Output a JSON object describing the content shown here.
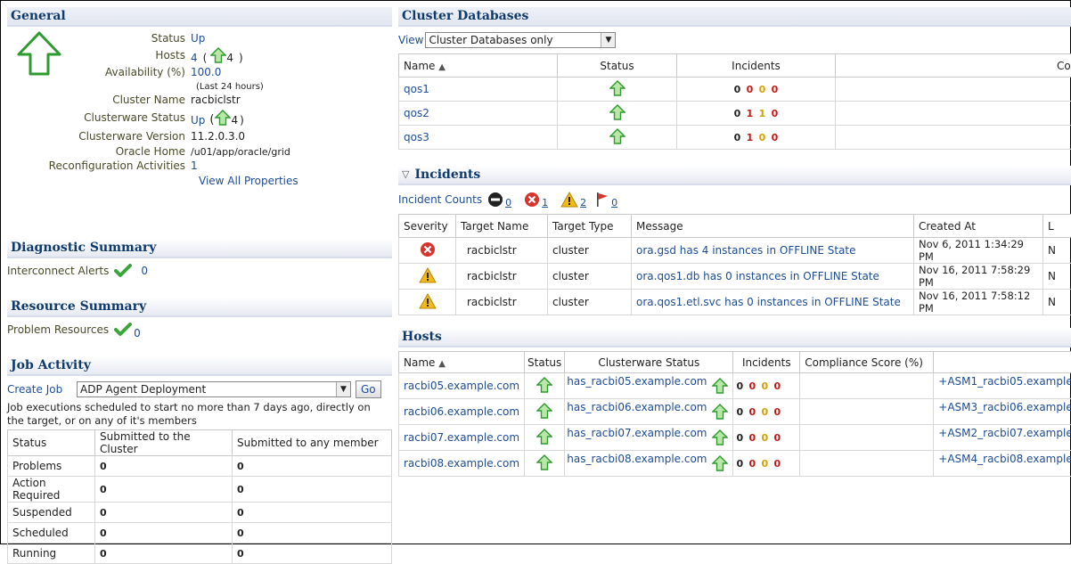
{
  "general": {
    "title": "General",
    "status_label": "Status",
    "status_value": "Up",
    "hosts_label": "Hosts",
    "hosts_value": "4",
    "hosts_paren_open": "(",
    "hosts_up_count": "4",
    "hosts_paren_close": ")",
    "availability_label": "Availability (%)",
    "availability_value": "100.0",
    "availability_note": "(Last 24 hours)",
    "cluster_name_label": "Cluster Name",
    "cluster_name_value": "racbiclstr",
    "cw_status_label": "Clusterware Status",
    "cw_status_value": "Up",
    "cw_paren_open": "(",
    "cw_up_count": "4",
    "cw_paren_close": ")",
    "cw_version_label": "Clusterware Version",
    "cw_version_value": "11.2.0.3.0",
    "oracle_home_label": "Oracle Home",
    "oracle_home_value": "/u01/app/oracle/grid",
    "reconfig_label": "Reconfiguration Activities",
    "reconfig_value": "1",
    "view_all": "View All Properties"
  },
  "diagnostic": {
    "title": "Diagnostic Summary",
    "interconnect_label": "Interconnect Alerts",
    "interconnect_value": "0"
  },
  "resource": {
    "title": "Resource Summary",
    "problem_label": "Problem Resources",
    "problem_value": "0"
  },
  "job": {
    "title": "Job Activity",
    "create_label": "Create Job",
    "select_value": "ADP Agent Deployment",
    "go": "Go",
    "desc": "Job executions scheduled to start no more than 7 days ago, directly on the target, or on any of it's members",
    "headers": [
      "Status",
      "Submitted to the Cluster",
      "Submitted to any member"
    ],
    "rows": [
      {
        "status": "Problems",
        "cluster": "0",
        "member": "0"
      },
      {
        "status": "Action Required",
        "cluster": "0",
        "member": "0"
      },
      {
        "status": "Suspended",
        "cluster": "0",
        "member": "0"
      },
      {
        "status": "Scheduled",
        "cluster": "0",
        "member": "0"
      },
      {
        "status": "Running",
        "cluster": "0",
        "member": "0"
      }
    ]
  },
  "cluster_db": {
    "title": "Cluster Databases",
    "view_label": "View",
    "view_value": "Cluster Databases only",
    "headers": [
      "Name",
      "Status",
      "Incidents",
      "Comp"
    ],
    "rows": [
      {
        "name": "qos1",
        "inc": [
          "0",
          "0",
          "0",
          "0"
        ]
      },
      {
        "name": "qos2",
        "inc": [
          "0",
          "1",
          "1",
          "0"
        ]
      },
      {
        "name": "qos3",
        "inc": [
          "0",
          "1",
          "0",
          "0"
        ]
      }
    ]
  },
  "incidents": {
    "title": "Incidents",
    "counts_label": "Incident Counts",
    "counts": [
      "0",
      "1",
      "2",
      "0"
    ],
    "headers": [
      "Severity",
      "Target Name",
      "Target Type",
      "Message",
      "Created At",
      "L"
    ],
    "rows": [
      {
        "sev": "critical",
        "target": "racbiclstr",
        "type": "cluster",
        "msg": "ora.gsd has 4 instances in OFFLINE State",
        "created": "Nov 6, 2011 1:34:29 PM",
        "l": "N"
      },
      {
        "sev": "warning",
        "target": "racbiclstr",
        "type": "cluster",
        "msg": "ora.qos1.db has 0 instances in OFFLINE State",
        "created": "Nov 16, 2011 7:58:29 PM",
        "l": "N"
      },
      {
        "sev": "warning",
        "target": "racbiclstr",
        "type": "cluster",
        "msg": "ora.qos1.etl.svc has 0 instances in OFFLINE State",
        "created": "Nov 16, 2011 7:58:12 PM",
        "l": "N"
      }
    ]
  },
  "hosts": {
    "title": "Hosts",
    "headers": [
      "Name",
      "Status",
      "Clusterware Status",
      "Incidents",
      "Compliance Score (%)",
      ""
    ],
    "rows": [
      {
        "name": "racbi05.example.com",
        "cw": "has_racbi05.example.com",
        "inc": [
          "0",
          "0",
          "0",
          "0"
        ],
        "asm": "+ASM1_racbi05.example"
      },
      {
        "name": "racbi06.example.com",
        "cw": "has_racbi06.example.com",
        "inc": [
          "0",
          "0",
          "0",
          "0"
        ],
        "asm": "+ASM3_racbi06.example"
      },
      {
        "name": "racbi07.example.com",
        "cw": "has_racbi07.example.com",
        "inc": [
          "0",
          "0",
          "0",
          "0"
        ],
        "asm": "+ASM2_racbi07.example"
      },
      {
        "name": "racbi08.example.com",
        "cw": "has_racbi08.example.com",
        "inc": [
          "0",
          "0",
          "0",
          "0"
        ],
        "asm": "+ASM4_racbi08.example"
      }
    ]
  }
}
